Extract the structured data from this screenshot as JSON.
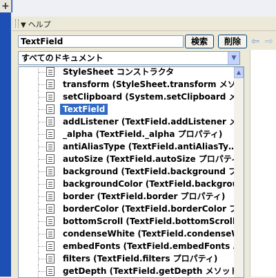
{
  "window": {
    "top_left_glyph": "+",
    "panel_title": "ヘルプ",
    "panel_collapse_glyph": "▼"
  },
  "search": {
    "value": "TextField",
    "search_button": "検索",
    "delete_button": "削除"
  },
  "nav": {
    "back_glyph": "⇦",
    "forward_glyph": "⇨"
  },
  "filter": {
    "selected": "すべてのドキュメント",
    "dropdown_glyph": "▼"
  },
  "tree": {
    "scroll_up_glyph": "▲",
    "items": [
      {
        "label": "StyleSheet コンストラクタ",
        "selected": false
      },
      {
        "label": "transform (StyleSheet.transform メソッ…",
        "selected": false
      },
      {
        "label": "setClipboard (System.setClipboard メ…",
        "selected": false
      },
      {
        "label": "TextField",
        "selected": true
      },
      {
        "label": "addListener (TextField.addListener メ…",
        "selected": false
      },
      {
        "label": "_alpha (TextField._alpha プロパティ)",
        "selected": false
      },
      {
        "label": "antiAliasType (TextField.antiAliasTy…",
        "selected": false
      },
      {
        "label": "autoSize (TextField.autoSize プロパティ)",
        "selected": false
      },
      {
        "label": "background (TextField.background プ…",
        "selected": false
      },
      {
        "label": "backgroundColor (TextField.backgrou…",
        "selected": false
      },
      {
        "label": "border (TextField.border プロパティ)",
        "selected": false
      },
      {
        "label": "borderColor (TextField.borderColor プ…",
        "selected": false
      },
      {
        "label": "bottomScroll (TextField.bottomScroll…",
        "selected": false
      },
      {
        "label": "condenseWhite (TextField.condenseW…",
        "selected": false
      },
      {
        "label": "embedFonts (TextField.embedFonts …",
        "selected": false
      },
      {
        "label": "filters (TextField.filters プロパティ)",
        "selected": false
      },
      {
        "label": "getDepth (TextField.getDepth メソッド)",
        "selected": false
      }
    ]
  },
  "colors": {
    "selection": "#316ac5",
    "frame_blue": "#1d4fb5"
  }
}
